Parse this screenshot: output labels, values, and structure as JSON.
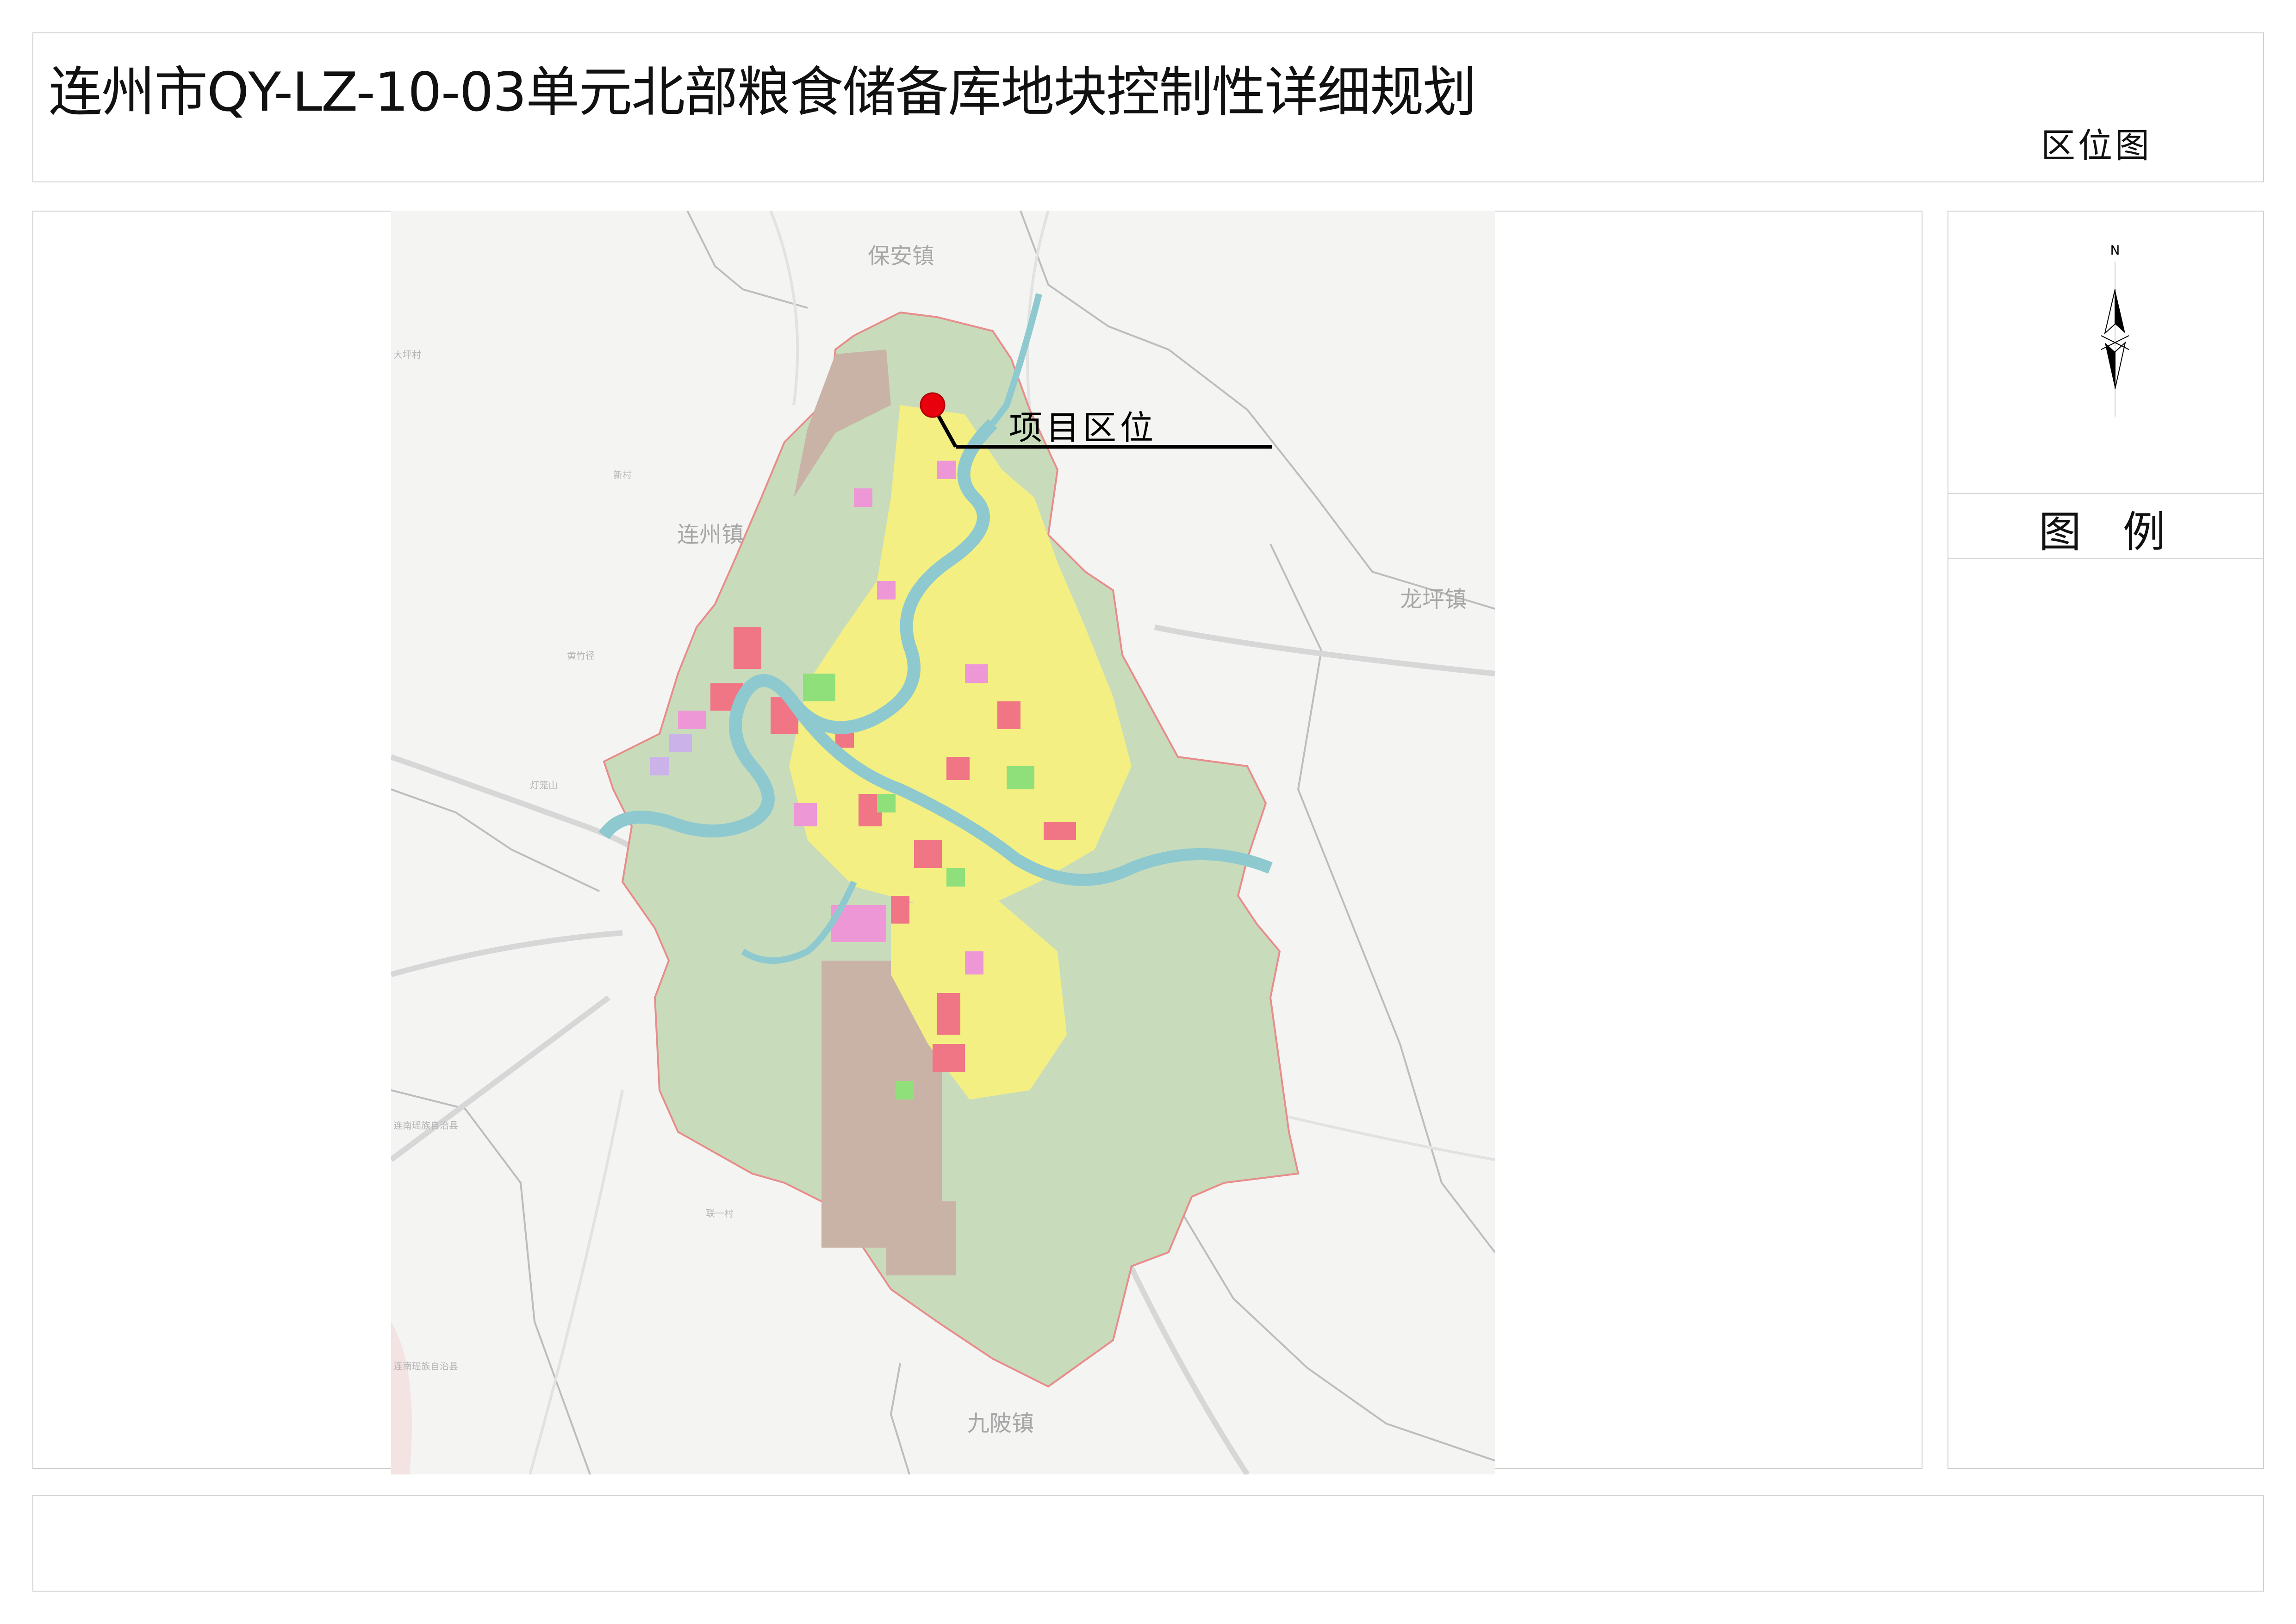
{
  "header": {
    "title": "连州市QY-LZ-10-03单元北部粮食储备库地块控制性详细规划",
    "sheet_name": "区位图"
  },
  "map": {
    "callout_label": "项目区位",
    "towns": {
      "baoan": "保安镇",
      "lianzhou": "连州镇",
      "longping": "龙坪镇",
      "jiupi": "九陂镇"
    },
    "small_places": {
      "dapingcun": "大坪村",
      "lianan_county_1": "连南瑶族自治县",
      "lianan_county_2": "连南瑶族自治县",
      "dengshan": "灯笼山",
      "xinjuncun": "新村",
      "huangfen": "黄竹径",
      "fengyi": "联一村"
    },
    "colors": {
      "water": "#8ec9cf",
      "green_land": "#c9dcbf",
      "residential": "#f6f17a",
      "commercial": "#f07585",
      "public": "#f09ad8",
      "industrial": "#c9b3a7",
      "park": "#8fe07a",
      "boundary": "#e88c8c",
      "road": "#cfcfcf",
      "marker": "#e8000c"
    }
  },
  "legend": {
    "north_label": "N",
    "title": "图例"
  }
}
